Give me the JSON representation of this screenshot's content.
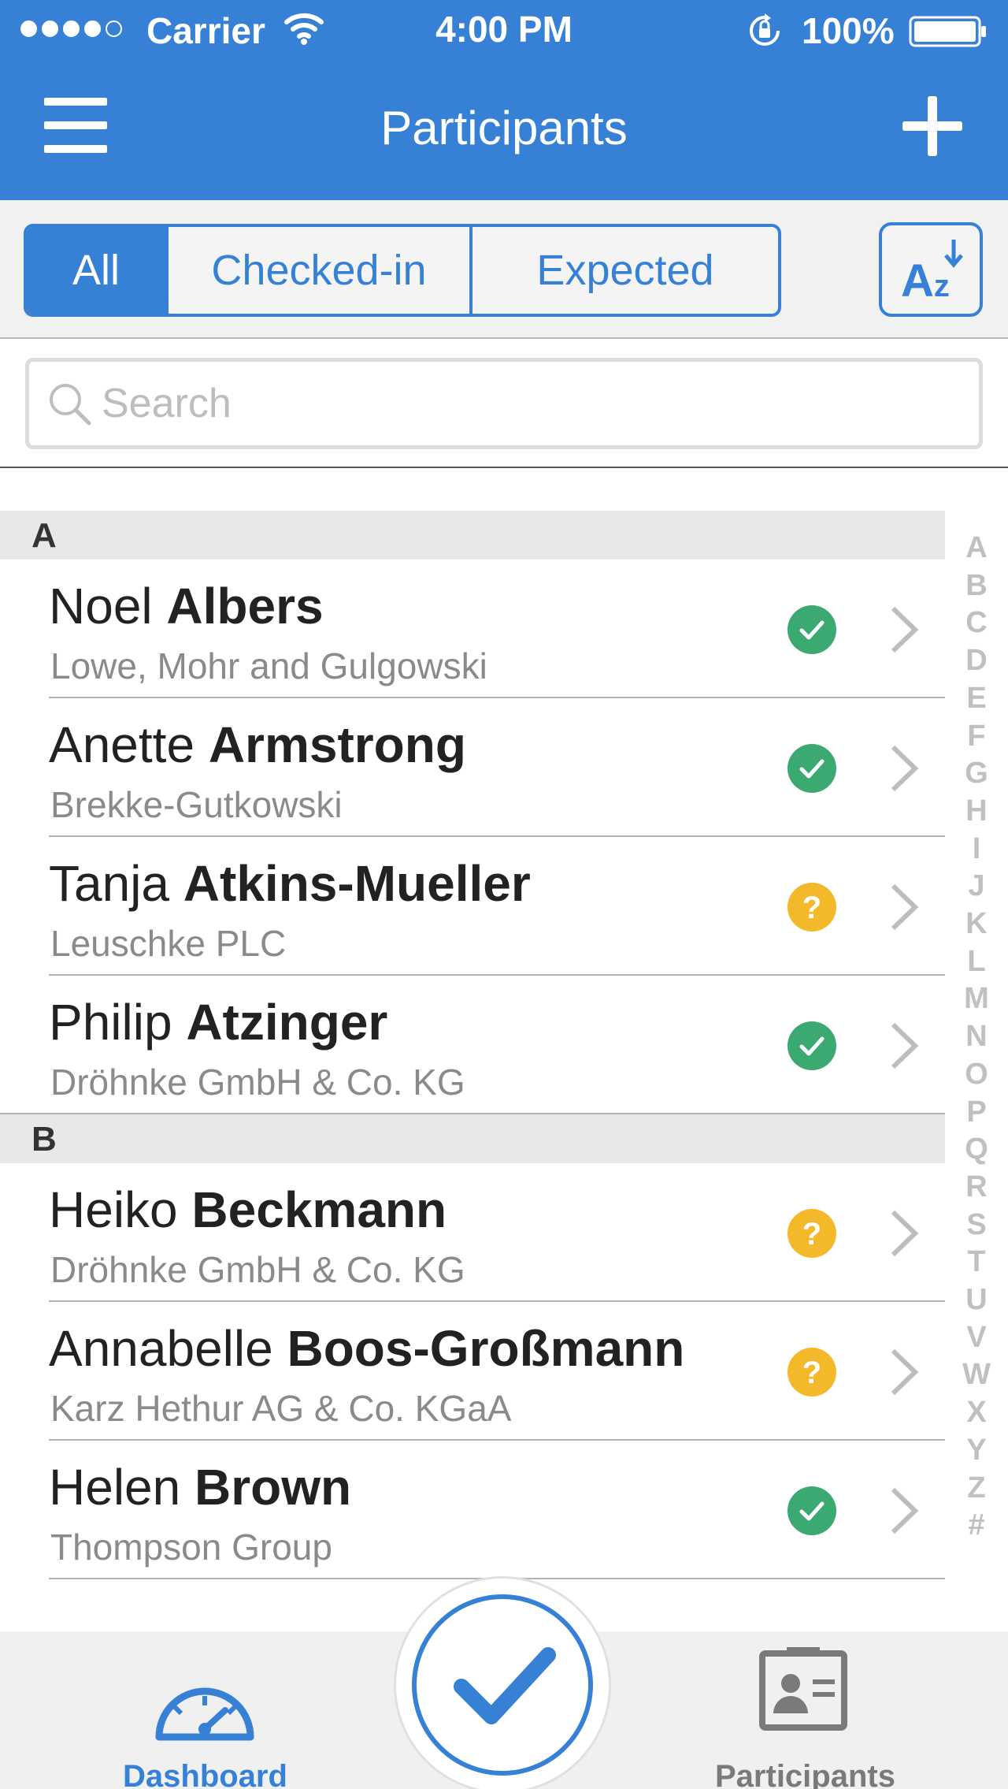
{
  "status_bar": {
    "carrier": "Carrier",
    "time": "4:00 PM",
    "battery": "100%"
  },
  "nav": {
    "title": "Participants",
    "menu_icon": "hamburger-menu-icon",
    "add_icon": "plus-icon"
  },
  "filter": {
    "segments": [
      "All",
      "Checked-in",
      "Expected"
    ],
    "selected": "All",
    "sort_icon": "sort-az-icon",
    "sort_letters": "A",
    "sort_letters_small": "z"
  },
  "search": {
    "placeholder": "Search",
    "value": ""
  },
  "sections": [
    {
      "letter": "A",
      "rows": [
        {
          "first": "Noel",
          "last": "Albers",
          "company": "Lowe, Mohr and Gulgowski",
          "status": "checked-in"
        },
        {
          "first": "Anette",
          "last": "Armstrong",
          "company": "Brekke-Gutkowski",
          "status": "checked-in"
        },
        {
          "first": "Tanja",
          "last": "Atkins-Mueller",
          "company": "Leuschke PLC",
          "status": "expected"
        },
        {
          "first": "Philip",
          "last": "Atzinger",
          "company": "Dröhnke GmbH & Co. KG",
          "status": "checked-in"
        }
      ]
    },
    {
      "letter": "B",
      "rows": [
        {
          "first": "Heiko",
          "last": "Beckmann",
          "company": "Dröhnke GmbH & Co. KG",
          "status": "expected"
        },
        {
          "first": "Annabelle",
          "last": "Boos-Großmann",
          "company": "Karz Hethur AG & Co. KGaA",
          "status": "expected"
        },
        {
          "first": "Helen",
          "last": "Brown",
          "company": "Thompson Group",
          "status": "checked-in"
        }
      ]
    }
  ],
  "index_letters": [
    "A",
    "B",
    "C",
    "D",
    "E",
    "F",
    "G",
    "H",
    "I",
    "J",
    "K",
    "L",
    "M",
    "N",
    "O",
    "P",
    "Q",
    "R",
    "S",
    "T",
    "U",
    "V",
    "W",
    "X",
    "Y",
    "Z",
    "#"
  ],
  "tab_bar": {
    "dashboard_label": "Dashboard",
    "participants_label": "Participants",
    "active": "Dashboard",
    "dashboard_icon": "speedometer-icon",
    "participants_icon": "id-card-icon",
    "checkin_icon": "checkmark-icon"
  },
  "colors": {
    "accent": "#3681d6",
    "checked_in": "#3aaa72",
    "expected": "#f3b92b",
    "tab_inactive": "#7a7a7a"
  }
}
